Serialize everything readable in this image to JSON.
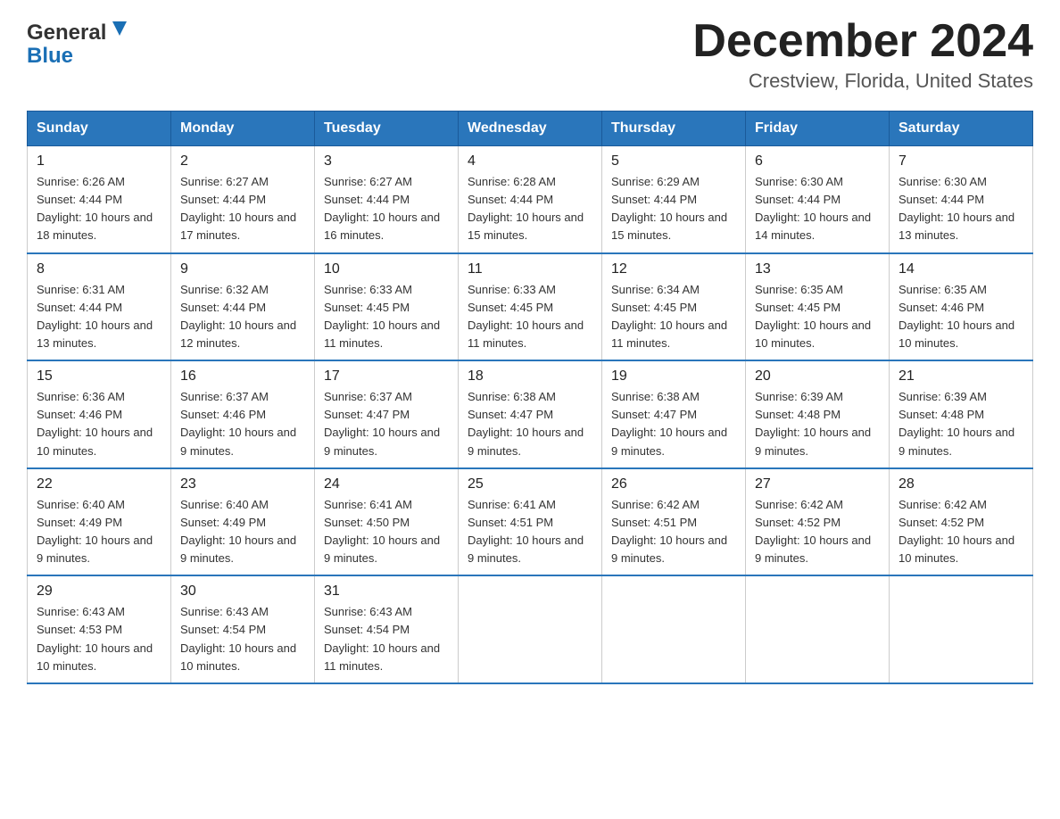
{
  "header": {
    "logo_general": "General",
    "logo_blue": "Blue",
    "month_title": "December 2024",
    "location": "Crestview, Florida, United States"
  },
  "days_of_week": [
    "Sunday",
    "Monday",
    "Tuesday",
    "Wednesday",
    "Thursday",
    "Friday",
    "Saturday"
  ],
  "weeks": [
    [
      {
        "day": "1",
        "sunrise": "6:26 AM",
        "sunset": "4:44 PM",
        "daylight": "10 hours and 18 minutes."
      },
      {
        "day": "2",
        "sunrise": "6:27 AM",
        "sunset": "4:44 PM",
        "daylight": "10 hours and 17 minutes."
      },
      {
        "day": "3",
        "sunrise": "6:27 AM",
        "sunset": "4:44 PM",
        "daylight": "10 hours and 16 minutes."
      },
      {
        "day": "4",
        "sunrise": "6:28 AM",
        "sunset": "4:44 PM",
        "daylight": "10 hours and 15 minutes."
      },
      {
        "day": "5",
        "sunrise": "6:29 AM",
        "sunset": "4:44 PM",
        "daylight": "10 hours and 15 minutes."
      },
      {
        "day": "6",
        "sunrise": "6:30 AM",
        "sunset": "4:44 PM",
        "daylight": "10 hours and 14 minutes."
      },
      {
        "day": "7",
        "sunrise": "6:30 AM",
        "sunset": "4:44 PM",
        "daylight": "10 hours and 13 minutes."
      }
    ],
    [
      {
        "day": "8",
        "sunrise": "6:31 AM",
        "sunset": "4:44 PM",
        "daylight": "10 hours and 13 minutes."
      },
      {
        "day": "9",
        "sunrise": "6:32 AM",
        "sunset": "4:44 PM",
        "daylight": "10 hours and 12 minutes."
      },
      {
        "day": "10",
        "sunrise": "6:33 AM",
        "sunset": "4:45 PM",
        "daylight": "10 hours and 11 minutes."
      },
      {
        "day": "11",
        "sunrise": "6:33 AM",
        "sunset": "4:45 PM",
        "daylight": "10 hours and 11 minutes."
      },
      {
        "day": "12",
        "sunrise": "6:34 AM",
        "sunset": "4:45 PM",
        "daylight": "10 hours and 11 minutes."
      },
      {
        "day": "13",
        "sunrise": "6:35 AM",
        "sunset": "4:45 PM",
        "daylight": "10 hours and 10 minutes."
      },
      {
        "day": "14",
        "sunrise": "6:35 AM",
        "sunset": "4:46 PM",
        "daylight": "10 hours and 10 minutes."
      }
    ],
    [
      {
        "day": "15",
        "sunrise": "6:36 AM",
        "sunset": "4:46 PM",
        "daylight": "10 hours and 10 minutes."
      },
      {
        "day": "16",
        "sunrise": "6:37 AM",
        "sunset": "4:46 PM",
        "daylight": "10 hours and 9 minutes."
      },
      {
        "day": "17",
        "sunrise": "6:37 AM",
        "sunset": "4:47 PM",
        "daylight": "10 hours and 9 minutes."
      },
      {
        "day": "18",
        "sunrise": "6:38 AM",
        "sunset": "4:47 PM",
        "daylight": "10 hours and 9 minutes."
      },
      {
        "day": "19",
        "sunrise": "6:38 AM",
        "sunset": "4:47 PM",
        "daylight": "10 hours and 9 minutes."
      },
      {
        "day": "20",
        "sunrise": "6:39 AM",
        "sunset": "4:48 PM",
        "daylight": "10 hours and 9 minutes."
      },
      {
        "day": "21",
        "sunrise": "6:39 AM",
        "sunset": "4:48 PM",
        "daylight": "10 hours and 9 minutes."
      }
    ],
    [
      {
        "day": "22",
        "sunrise": "6:40 AM",
        "sunset": "4:49 PM",
        "daylight": "10 hours and 9 minutes."
      },
      {
        "day": "23",
        "sunrise": "6:40 AM",
        "sunset": "4:49 PM",
        "daylight": "10 hours and 9 minutes."
      },
      {
        "day": "24",
        "sunrise": "6:41 AM",
        "sunset": "4:50 PM",
        "daylight": "10 hours and 9 minutes."
      },
      {
        "day": "25",
        "sunrise": "6:41 AM",
        "sunset": "4:51 PM",
        "daylight": "10 hours and 9 minutes."
      },
      {
        "day": "26",
        "sunrise": "6:42 AM",
        "sunset": "4:51 PM",
        "daylight": "10 hours and 9 minutes."
      },
      {
        "day": "27",
        "sunrise": "6:42 AM",
        "sunset": "4:52 PM",
        "daylight": "10 hours and 9 minutes."
      },
      {
        "day": "28",
        "sunrise": "6:42 AM",
        "sunset": "4:52 PM",
        "daylight": "10 hours and 10 minutes."
      }
    ],
    [
      {
        "day": "29",
        "sunrise": "6:43 AM",
        "sunset": "4:53 PM",
        "daylight": "10 hours and 10 minutes."
      },
      {
        "day": "30",
        "sunrise": "6:43 AM",
        "sunset": "4:54 PM",
        "daylight": "10 hours and 10 minutes."
      },
      {
        "day": "31",
        "sunrise": "6:43 AM",
        "sunset": "4:54 PM",
        "daylight": "10 hours and 11 minutes."
      },
      null,
      null,
      null,
      null
    ]
  ]
}
